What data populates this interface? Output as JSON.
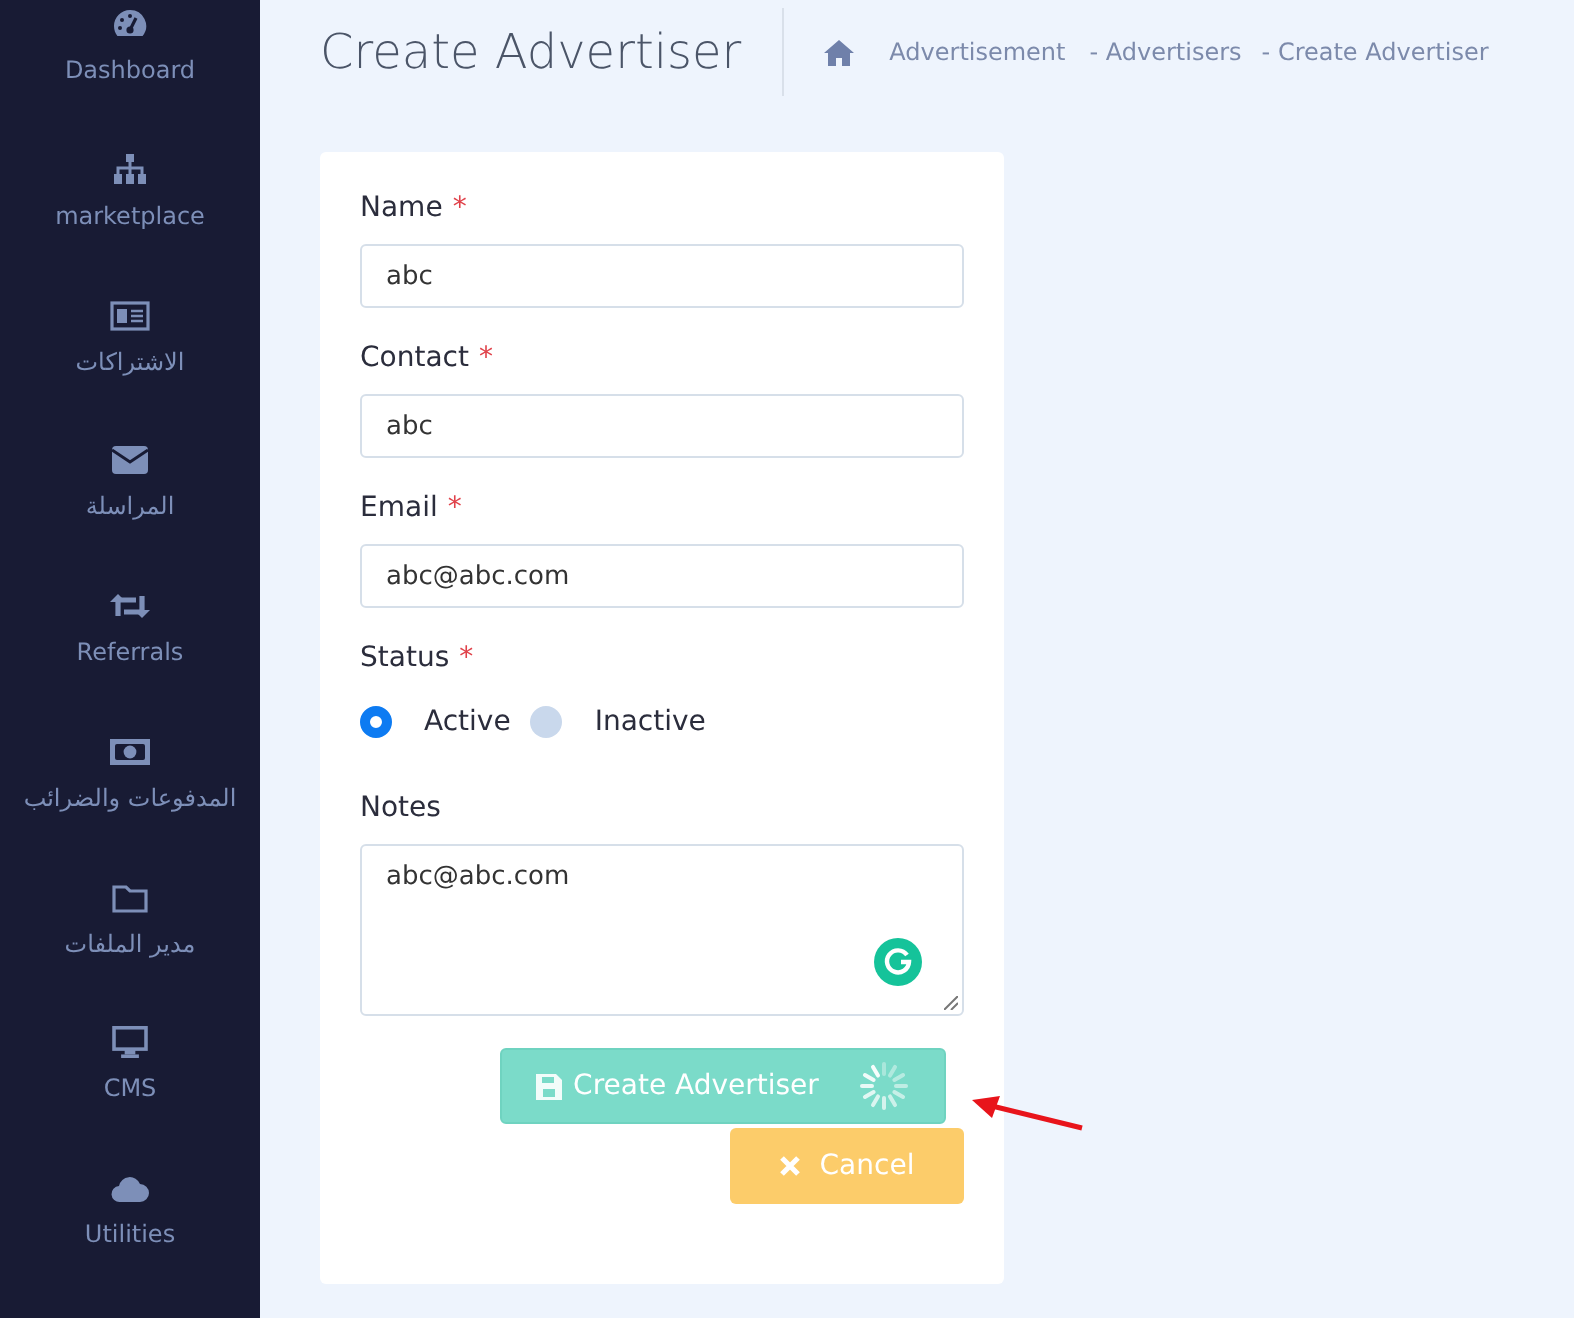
{
  "sidebar": {
    "items": [
      {
        "label": "Dashboard"
      },
      {
        "label": "marketplace"
      },
      {
        "label": "الاشتراكات"
      },
      {
        "label": "المراسلة"
      },
      {
        "label": "Referrals"
      },
      {
        "label": "المدفوعات والضرائب"
      },
      {
        "label": "مدير الملفات"
      },
      {
        "label": "CMS"
      },
      {
        "label": "Utilities"
      }
    ]
  },
  "header": {
    "title": "Create Advertiser",
    "breadcrumb": [
      "Advertisement",
      "- Advertisers",
      "- Create Advertiser"
    ]
  },
  "form": {
    "fields": [
      {
        "kind": "text",
        "label": "Name",
        "required_mark": "*",
        "value": "abc"
      },
      {
        "kind": "text",
        "label": "Contact",
        "required_mark": "*",
        "value": "abc"
      },
      {
        "kind": "text",
        "label": "Email",
        "required_mark": "*",
        "value": "abc@abc.com"
      },
      {
        "kind": "radio",
        "label": "Status",
        "required_mark": "*",
        "options": [
          {
            "label": "Active",
            "selected": true
          },
          {
            "label": "Inactive",
            "selected": false
          }
        ]
      },
      {
        "kind": "textarea",
        "label": "Notes",
        "value": "abc@abc.com"
      }
    ],
    "submit": {
      "label": "Create Advertiser",
      "loading": true
    },
    "cancel": {
      "label": "Cancel"
    }
  }
}
